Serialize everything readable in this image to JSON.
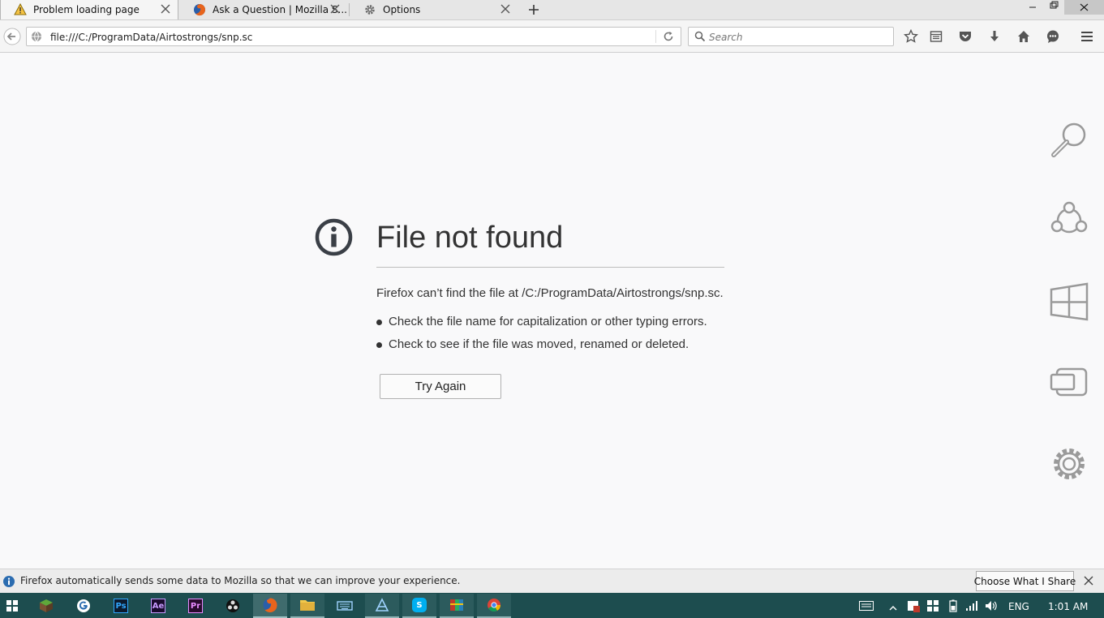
{
  "tabs": [
    {
      "label": "Problem loading page",
      "icon": "warning-icon",
      "active": true
    },
    {
      "label": "Ask a Question | Mozilla S...",
      "icon": "firefox-icon",
      "active": false
    },
    {
      "label": "Options",
      "icon": "gear-icon",
      "active": false
    }
  ],
  "navbar": {
    "url": "file:///C:/ProgramData/Airtostrongs/snp.sc",
    "search_placeholder": "Search"
  },
  "error_page": {
    "title": "File not found",
    "description": "Firefox can’t find the file at /C:/ProgramData/Airtostrongs/snp.sc.",
    "suggestions": [
      "Check the file name for capitalization or other typing errors.",
      "Check to see if the file was moved, renamed or deleted."
    ],
    "try_again_label": "Try Again"
  },
  "charms": [
    "search-charm-icon",
    "share-charm-icon",
    "start-charm-icon",
    "devices-charm-icon",
    "settings-charm-icon"
  ],
  "notification": {
    "text": "Firefox automatically sends some data to Mozilla so that we can improve your experience.",
    "button_label": "Choose What I Share"
  },
  "taskbar": {
    "apps": [
      "start-icon",
      "minecraft-icon",
      "google-icon",
      "photoshop-icon",
      "after-effects-icon",
      "premiere-icon",
      "obs-icon",
      "firefox-icon",
      "file-explorer-icon",
      "keyboard-icon",
      "game-icon",
      "skype-icon",
      "winrar-icon",
      "chrome-icon"
    ],
    "app_labels": {
      "photoshop": "Ps",
      "after_effects": "Ae",
      "premiere": "Pr",
      "skype": "S"
    },
    "language": "ENG",
    "time": "1:01 AM"
  },
  "colors": {
    "taskbar": "#1d4d4f",
    "page_bg": "#f9f9fa",
    "text": "#333333",
    "info_blue": "#0a84ff"
  }
}
